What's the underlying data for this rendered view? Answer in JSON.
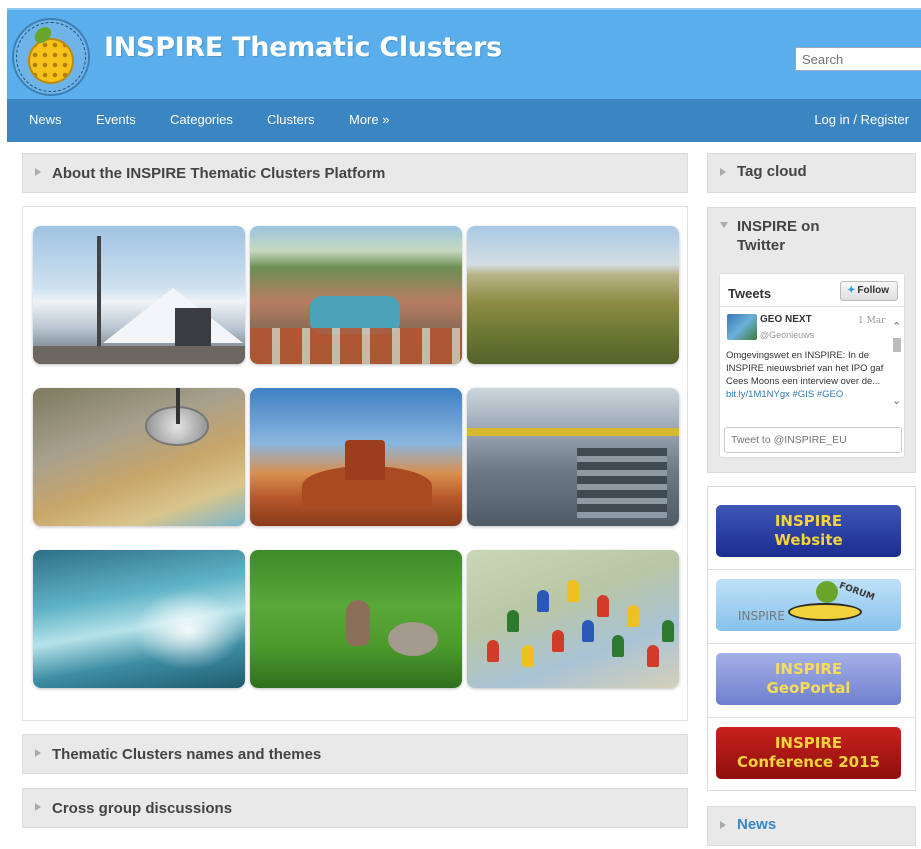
{
  "header": {
    "site_title": "INSPIRE Thematic Clusters",
    "search_placeholder": "Search"
  },
  "nav": {
    "items": [
      {
        "label": "News"
      },
      {
        "label": "Events"
      },
      {
        "label": "Categories"
      },
      {
        "label": "Clusters"
      },
      {
        "label": "More »"
      }
    ],
    "login_label": "Log in / Register"
  },
  "main": {
    "sections": [
      {
        "title": "About the INSPIRE Thematic Clusters Platform"
      },
      {
        "title": "Thematic Clusters names and themes"
      },
      {
        "title": "Cross group discussions"
      }
    ],
    "gallery": [
      {
        "subject": "mountain-station"
      },
      {
        "subject": "lakeside-town"
      },
      {
        "subject": "plain-landscape"
      },
      {
        "subject": "maps-and-compass"
      },
      {
        "subject": "desert-butte"
      },
      {
        "subject": "industrial-hall"
      },
      {
        "subject": "ocean-wave"
      },
      {
        "subject": "squirrel-on-grass"
      },
      {
        "subject": "map-with-pins"
      }
    ]
  },
  "sidebar": {
    "tag_cloud_title": "Tag cloud",
    "twitter_title": "INSPIRE on Twitter",
    "twitter": {
      "header": "Tweets",
      "follow_label": "Follow",
      "tweet": {
        "user": "GEO NEXT",
        "handle": "@Geonieuws",
        "date": "1 Mar",
        "text": "Omgevingswet en INSPIRE: In de INSPIRE nieuwsbrief van het IPO gaf Cees Moons een interview over de...",
        "link_text": "bit.ly/1M1NYgx #GIS #GEO"
      },
      "compose_placeholder": "Tweet to @INSPIRE_EU"
    },
    "banners": {
      "website": {
        "line1": "INSPIRE",
        "line2": "Website"
      },
      "forum": {
        "word": "INSPIRE",
        "badge": "FORUM"
      },
      "geoportal": {
        "line1": "INSPIRE",
        "line2": "GeoPortal"
      },
      "conference": {
        "line1": "INSPIRE",
        "line2": "Conference 2015"
      }
    },
    "news_title": "News"
  },
  "colors": {
    "header_bg": "#5aaeeb",
    "nav_bg": "#3b85c3",
    "panel_bg": "#e9e9e9"
  }
}
